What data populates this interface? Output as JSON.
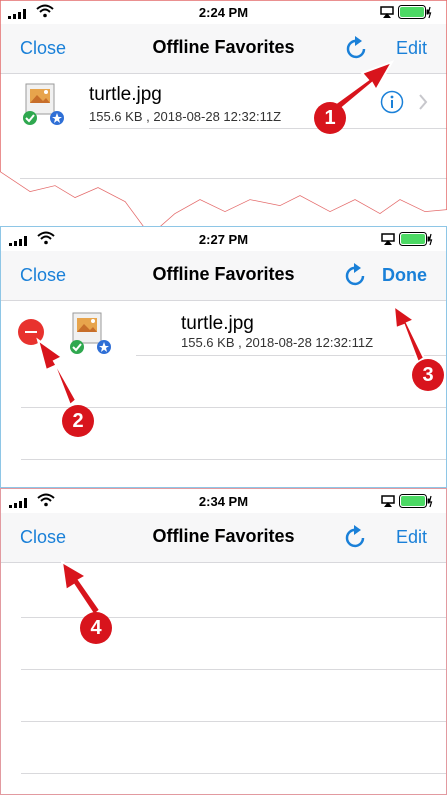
{
  "panels": [
    {
      "status_time": "2:24 PM",
      "nav": {
        "left": "Close",
        "title": "Offline Favorites",
        "right": "Edit"
      },
      "file": {
        "name": "turtle.jpg",
        "meta": "155.6 KB , 2018-08-28 12:32:11Z"
      }
    },
    {
      "status_time": "2:27 PM",
      "nav": {
        "left": "Close",
        "title": "Offline Favorites",
        "right": "Done"
      },
      "file": {
        "name": "turtle.jpg",
        "meta": "155.6 KB , 2018-08-28 12:32:11Z"
      }
    },
    {
      "status_time": "2:34 PM",
      "nav": {
        "left": "Close",
        "title": "Offline Favorites",
        "right": "Edit"
      }
    }
  ],
  "badges": [
    "1",
    "2",
    "3",
    "4"
  ],
  "icons": {
    "signal": "signal-bars-icon",
    "wifi": "wifi-icon",
    "airplay": "airplay-icon",
    "battery": "battery-charging-icon",
    "refresh": "refresh-icon",
    "info": "info-icon",
    "chevron": "chevron-right-icon",
    "file": "image-file-icon",
    "delete": "delete-minus-icon"
  },
  "colors": {
    "accent": "#1a80d8",
    "annotation": "#d8141c",
    "delete": "#e8322e",
    "battery": "#4cd964"
  }
}
